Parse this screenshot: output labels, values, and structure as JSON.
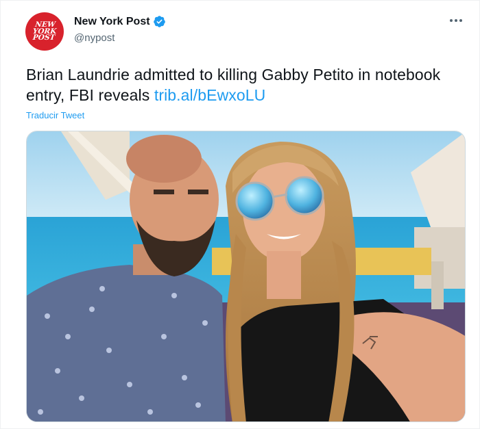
{
  "account": {
    "name": "New York Post",
    "handle": "@nypost",
    "avatar_text": "NEW YORK POST",
    "verified_icon": "verified-badge-icon",
    "verified_color": "#1d9bf0"
  },
  "menu": {
    "more_icon": "more-options-icon"
  },
  "tweet": {
    "text": "Brian Laundrie admitted to killing Gabby Petito in notebook entry, FBI reveals",
    "link": "trib.al/bEwxoLU",
    "link_color": "#1d9bf0"
  },
  "translate_label": "Traducir Tweet",
  "media": {
    "type": "photo"
  }
}
